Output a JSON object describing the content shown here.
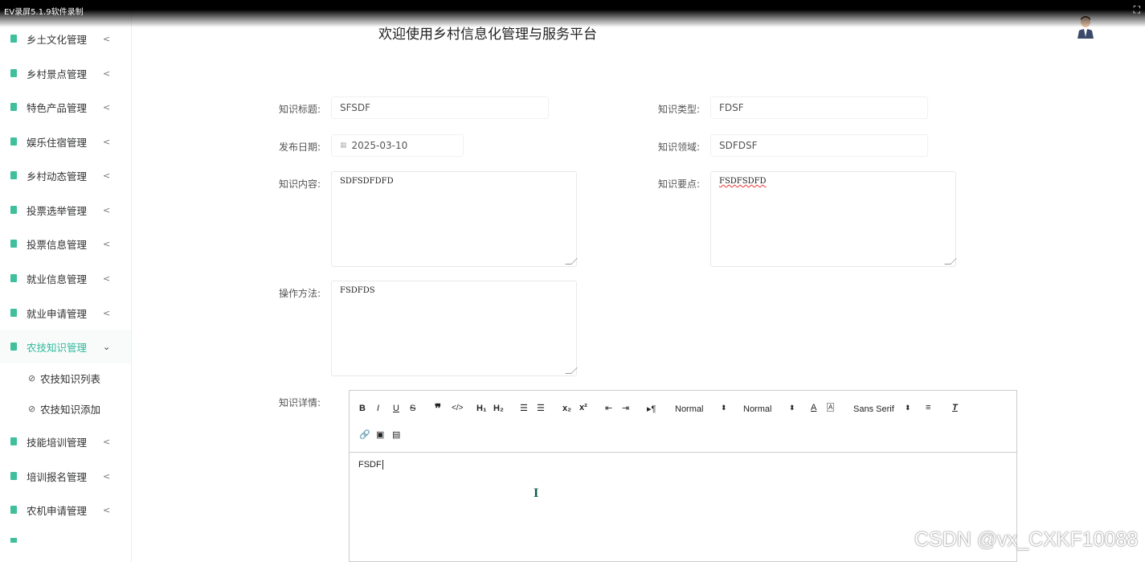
{
  "recorder": {
    "title": "EV录屏5.1.9软件录制"
  },
  "header": {
    "title": "欢迎使用乡村信息化管理与服务平台"
  },
  "sidebar": {
    "items": [
      {
        "label": "乡土文化管理"
      },
      {
        "label": "乡村景点管理"
      },
      {
        "label": "特色产品管理"
      },
      {
        "label": "娱乐住宿管理"
      },
      {
        "label": "乡村动态管理"
      },
      {
        "label": "投票选举管理"
      },
      {
        "label": "投票信息管理"
      },
      {
        "label": "就业信息管理"
      },
      {
        "label": "就业申请管理"
      },
      {
        "label": "农技知识管理"
      },
      {
        "label": "技能培训管理"
      },
      {
        "label": "培训报名管理"
      },
      {
        "label": "农机申请管理"
      }
    ],
    "subitems": [
      {
        "label": "农技知识列表"
      },
      {
        "label": "农技知识添加"
      }
    ]
  },
  "form": {
    "title_label": "知识标题:",
    "title_value": "SFSDF",
    "type_label": "知识类型:",
    "type_value": "FDSF",
    "date_label": "发布日期:",
    "date_value": "2025-03-10",
    "field_label": "知识领域:",
    "field_value": "SDFDSF",
    "content_label": "知识内容:",
    "content_value": "SDFSDFDFD",
    "points_label": "知识要点:",
    "points_value": "FSDFSDFD",
    "method_label": "操作方法:",
    "method_value": "FSDFDS",
    "detail_label": "知识详情:"
  },
  "editor": {
    "header_select": "Normal",
    "size_select": "Normal",
    "font_select": "Sans Serif",
    "content": "FSDF"
  },
  "watermark": "CSDN @vx_CXKF10088",
  "colors": {
    "accent": "#2fb99c",
    "icon": "#3fbf9c"
  }
}
